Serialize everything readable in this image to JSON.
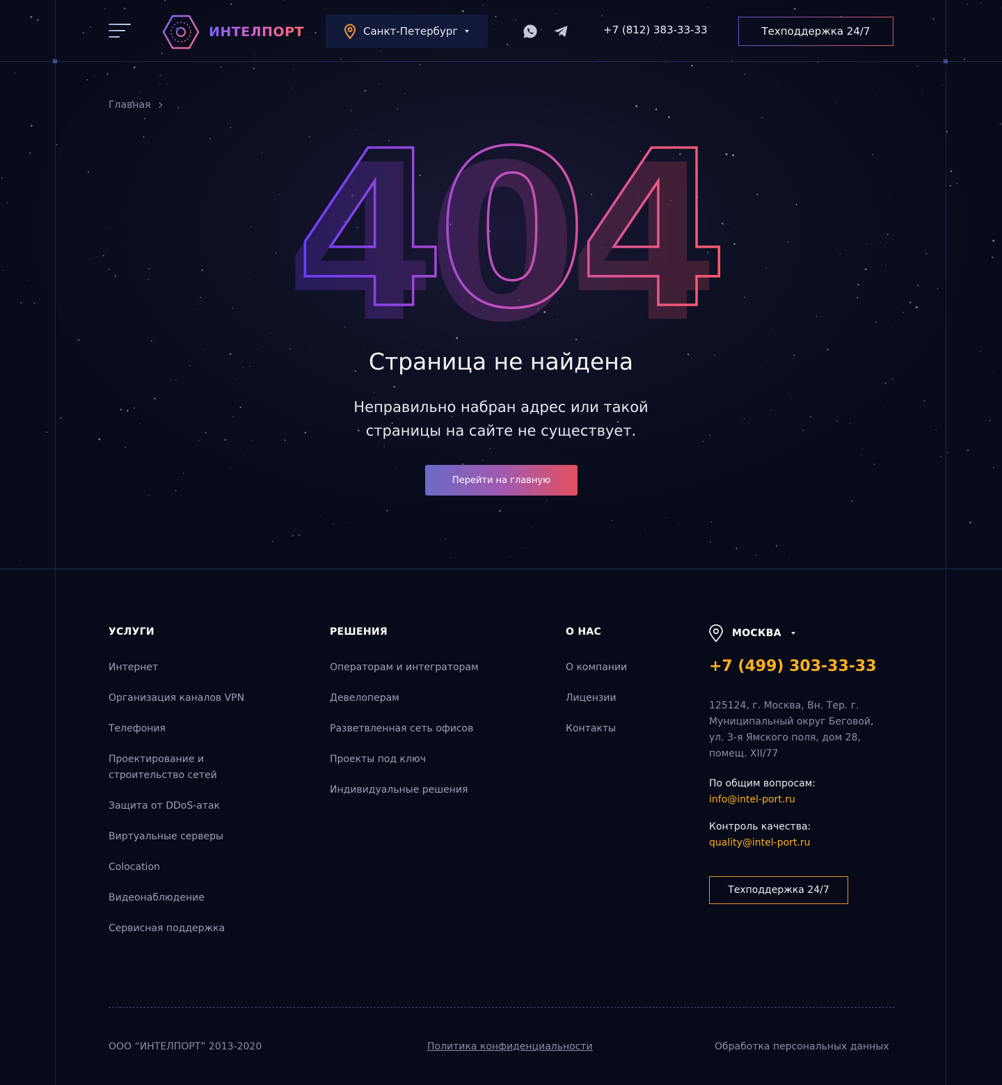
{
  "header": {
    "logo_text": "ИНТЕЛПОРТ",
    "city": "Санкт-Петербург",
    "phone": "+7 (812) 383-33-33",
    "support_label": "Техподдержка 24/7",
    "icons": [
      "menu-icon",
      "location-pin-icon",
      "whatsapp-icon",
      "telegram-icon"
    ]
  },
  "breadcrumb": {
    "home": "Главная"
  },
  "error": {
    "code": "404",
    "title": "Страница не найдена",
    "text": "Неправильно набран адрес или такой страницы на сайте не существует.",
    "button_label": "Перейти на главную"
  },
  "footer": {
    "services": {
      "title": "УСЛУГИ",
      "items": [
        "Интернет",
        "Организация каналов VPN",
        "Телефония",
        "Проектирование и строительство сетей",
        "Защита от DDoS-атак",
        "Виртуальные серверы",
        "Colocation",
        "Видеонаблюдение",
        "Сервисная поддержка"
      ]
    },
    "solutions": {
      "title": "РЕШЕНИЯ",
      "items": [
        "Операторам и интеграторам",
        "Девелоперам",
        "Разветвленная сеть офисов",
        "Проекты под ключ",
        "Индивидуальные решения"
      ]
    },
    "about": {
      "title": "О НАС",
      "items": [
        "О компании",
        "Лицензии",
        "Контакты"
      ]
    },
    "contacts": {
      "city": "МОСКВА",
      "phone": "+7 (499) 303-33-33",
      "address": "125124, г. Москва, Вн. Тер. г. Муниципальный округ Беговой, ул. 3-я Ямского поля, дом 28, помещ. XII/77",
      "general_label": "По общим вопросам:",
      "general_email": "info@intel-port.ru",
      "quality_label": "Контроль качества:",
      "quality_email": "quality@intel-port.ru",
      "support_label": "Техподдержка 24/7"
    },
    "bottom": {
      "copyright": "ООО “ИНТЕЛПОРТ” 2013-2020",
      "privacy": "Политика конфиденциальности",
      "personal_data": "Обработка персональных данных"
    }
  },
  "colors": {
    "background": "#070a18",
    "accent_orange": "#ffb020",
    "gradient_start": "#6a4cff",
    "gradient_mid": "#c04fc2",
    "gradient_end": "#ff5a6a"
  }
}
